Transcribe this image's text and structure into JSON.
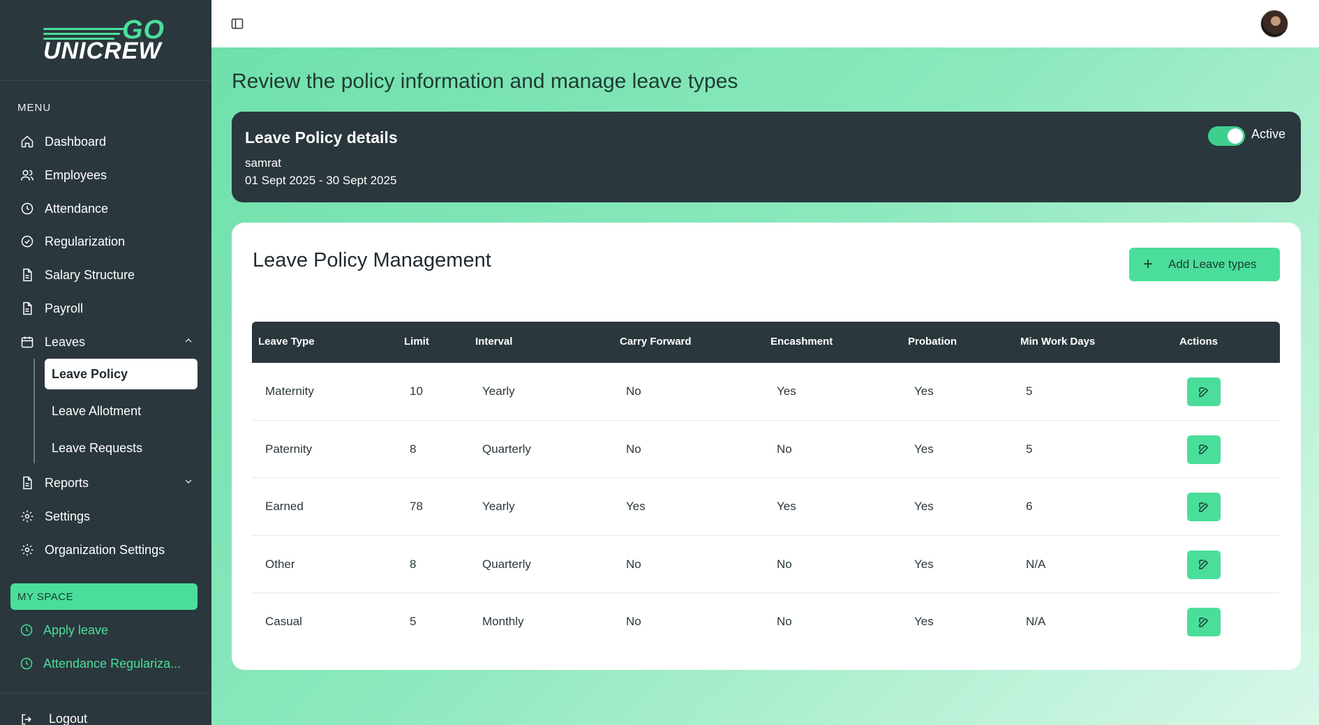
{
  "brand": {
    "logo_top": "GO",
    "logo_bottom": "UNICREW"
  },
  "sidebar": {
    "menu_label": "MENU",
    "items": [
      {
        "label": "Dashboard",
        "icon": "home-icon"
      },
      {
        "label": "Employees",
        "icon": "users-icon"
      },
      {
        "label": "Attendance",
        "icon": "clock-icon"
      },
      {
        "label": "Regularization",
        "icon": "check-circle-icon"
      },
      {
        "label": "Salary Structure",
        "icon": "document-icon"
      },
      {
        "label": "Payroll",
        "icon": "document-icon"
      },
      {
        "label": "Leaves",
        "icon": "calendar-icon"
      },
      {
        "label": "Reports",
        "icon": "document-icon"
      },
      {
        "label": "Settings",
        "icon": "gear-icon"
      },
      {
        "label": "Organization Settings",
        "icon": "gear-icon"
      }
    ],
    "leave_sub": [
      {
        "label": "Leave Policy",
        "active": true
      },
      {
        "label": "Leave Allotment",
        "active": false
      },
      {
        "label": "Leave Requests",
        "active": false
      }
    ],
    "myspace_label": "MY SPACE",
    "myspace_items": [
      {
        "label": "Apply leave"
      },
      {
        "label": "Attendance Regulariza..."
      }
    ],
    "logout_label": "Logout"
  },
  "main": {
    "page_title": "Review the policy information and manage leave types",
    "policy": {
      "heading": "Leave Policy details",
      "name": "samrat",
      "dates": "01 Sept 2025 - 30 Sept 2025",
      "status_label": "Active",
      "active": true
    },
    "management": {
      "title": "Leave Policy Management",
      "add_button": "Add Leave types",
      "columns": [
        "Leave Type",
        "Limit",
        "Interval",
        "Carry Forward",
        "Encashment",
        "Probation",
        "Min Work Days",
        "Actions"
      ],
      "rows": [
        [
          "Maternity",
          "10",
          "Yearly",
          "No",
          "Yes",
          "Yes",
          "5"
        ],
        [
          "Paternity",
          "8",
          "Quarterly",
          "No",
          "No",
          "Yes",
          "5"
        ],
        [
          "Earned",
          "78",
          "Yearly",
          "Yes",
          "Yes",
          "Yes",
          "6"
        ],
        [
          "Other",
          "8",
          "Quarterly",
          "No",
          "No",
          "Yes",
          "N/A"
        ],
        [
          "Casual",
          "5",
          "Monthly",
          "No",
          "No",
          "Yes",
          "N/A"
        ]
      ]
    }
  },
  "colors": {
    "accent": "#4ade9a",
    "sidebar_bg": "#2a373d"
  }
}
